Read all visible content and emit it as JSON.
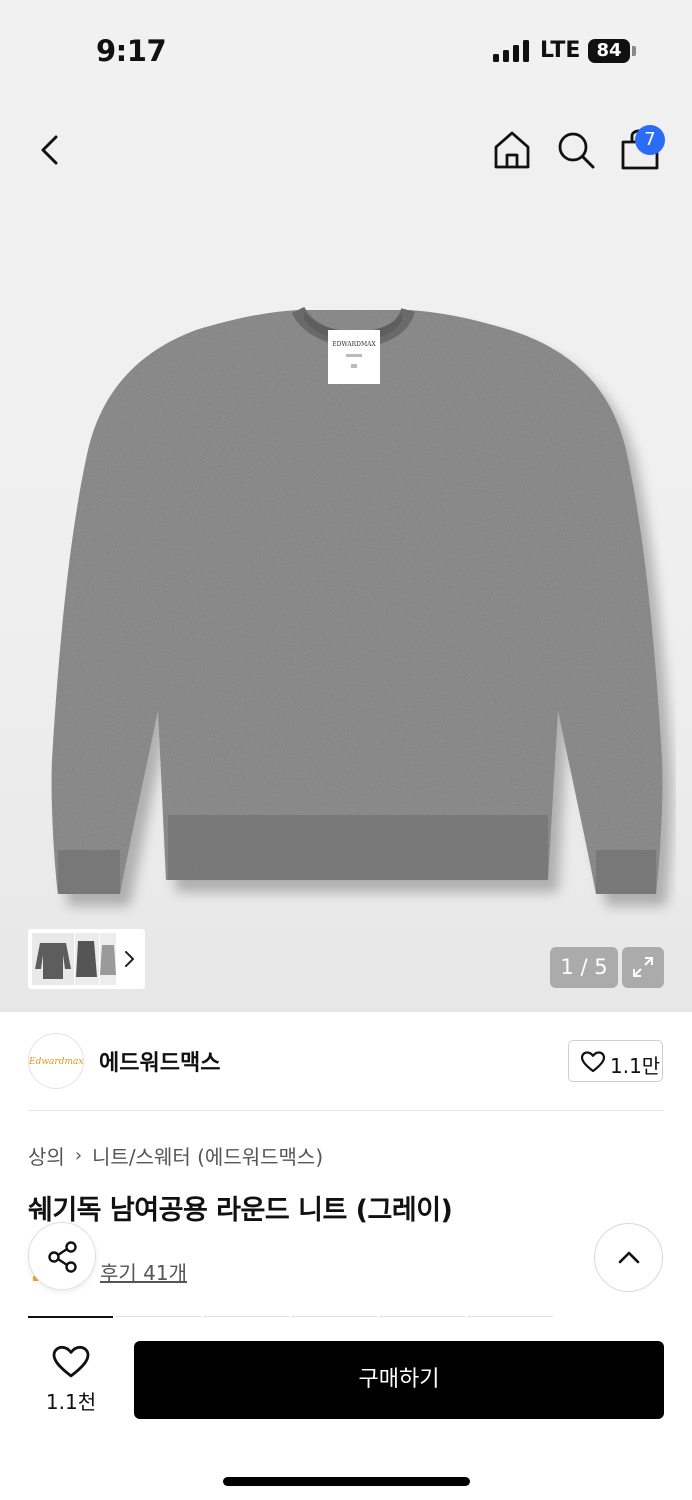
{
  "status_bar": {
    "time": "9:17",
    "carrier": "LTE",
    "battery": "84"
  },
  "nav": {
    "cart_badge": "7"
  },
  "gallery": {
    "pager": "1 / 5"
  },
  "brand": {
    "logo_text": "Edwardmax",
    "name": "에드워드맥스",
    "likes": "1.1만"
  },
  "breadcrumb": {
    "category": "상의",
    "subcategory": "니트/스웨터 (에드워드맥스)"
  },
  "product": {
    "title": "쉐기독 남여공용 라운드 니트 (그레이)",
    "reviews": "후기 41개",
    "label_text": "EDWARDMAX"
  },
  "bottom_bar": {
    "wish_count": "1.1천",
    "buy_label": "구매하기"
  },
  "colors": {
    "accent_blue": "#2a6cf6",
    "buy_button": "#000000",
    "review_star": "#f2a51c",
    "sweater_gray": "#7b7b7b"
  },
  "icons": [
    "back-icon",
    "home-icon",
    "search-icon",
    "shopping-bag-icon",
    "chevron-right-icon",
    "expand-icon",
    "heart-icon",
    "share-icon",
    "chevron-up-icon"
  ]
}
